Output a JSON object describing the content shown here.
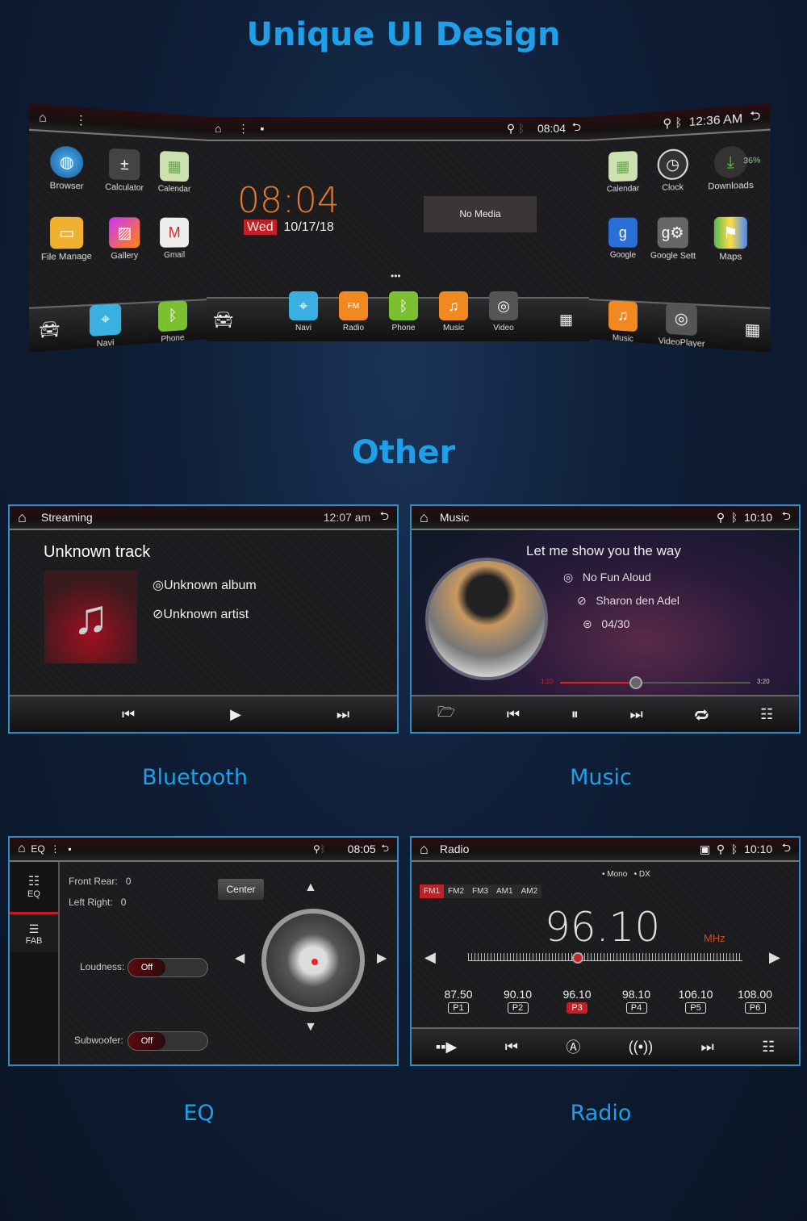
{
  "headings": {
    "title": "Unique UI Design",
    "other": "Other"
  },
  "captions": {
    "bluetooth": "Bluetooth",
    "music": "Music",
    "eq": "EQ",
    "radio": "Radio"
  },
  "left_screen": {
    "apps": [
      {
        "label": "Browser",
        "icon": "globe-icon"
      },
      {
        "label": "Calculator",
        "icon": "calculator-icon"
      },
      {
        "label": "Calendar",
        "icon": "calendar-icon"
      },
      {
        "label": "File Manage",
        "icon": "folder-icon"
      },
      {
        "label": "Gallery",
        "icon": "gallery-icon"
      },
      {
        "label": "Gmail",
        "icon": "gmail-icon"
      }
    ],
    "dock": [
      {
        "label": "Navi"
      },
      {
        "label": "Phone"
      }
    ]
  },
  "center_screen": {
    "time": "08:04",
    "status_time": "08:04",
    "day": "Wed",
    "date": "10/17/18",
    "media": "No Media",
    "dock": [
      {
        "label": "Navi"
      },
      {
        "label": "Radio"
      },
      {
        "label": "Phone"
      },
      {
        "label": "Music"
      },
      {
        "label": "Video"
      }
    ],
    "radio_fm": "FM"
  },
  "right_screen": {
    "status_time": "12:36 AM",
    "apps": [
      {
        "label": "Calendar"
      },
      {
        "label": "Clock"
      },
      {
        "label": "Downloads"
      },
      {
        "label": "Google"
      },
      {
        "label": "Google Sett"
      },
      {
        "label": "Maps"
      }
    ],
    "download_pct": "36%",
    "dock": [
      {
        "label": "Music"
      },
      {
        "label": "VideoPlayer"
      }
    ]
  },
  "bluetooth": {
    "title": "Streaming",
    "time": "12:07 am",
    "track": "Unknown track",
    "album": "Unknown album",
    "artist": "Unknown artist"
  },
  "music": {
    "title": "Music",
    "time": "10:10",
    "song": "Let me show you the way",
    "album": "No Fun Aloud",
    "artist": "Sharon den Adel",
    "track_no": "04/30",
    "elapsed": "1:20",
    "total": "3:20",
    "progress": 0.4
  },
  "eq": {
    "title": "EQ",
    "time": "08:05",
    "tabs": [
      {
        "label": "EQ"
      },
      {
        "label": "FAB"
      }
    ],
    "front_rear_label": "Front Rear:",
    "front_rear": "0",
    "left_right_label": "Left Right:",
    "left_right": "0",
    "center": "Center",
    "loudness_label": "Loudness:",
    "loudness": "Off",
    "subwoofer_label": "Subwoofer:",
    "subwoofer": "Off"
  },
  "radio": {
    "title": "Radio",
    "time": "10:10",
    "mono": "Mono",
    "dx": "DX",
    "bands": [
      "FM1",
      "FM2",
      "FM3",
      "AM1",
      "AM2"
    ],
    "active_band": "FM1",
    "frequency": "96.10",
    "unit": "MHz",
    "presets": [
      {
        "freq": "87.50",
        "label": "P1"
      },
      {
        "freq": "90.10",
        "label": "P2"
      },
      {
        "freq": "96.10",
        "label": "P3",
        "active": true
      },
      {
        "freq": "98.10",
        "label": "P4"
      },
      {
        "freq": "106.10",
        "label": "P5"
      },
      {
        "freq": "108.00",
        "label": "P6"
      }
    ],
    "tuner_position": 0.4
  },
  "colors": {
    "accent": "#1f9fe8",
    "red": "#e0262e",
    "clock_orange": "#e8782a"
  }
}
